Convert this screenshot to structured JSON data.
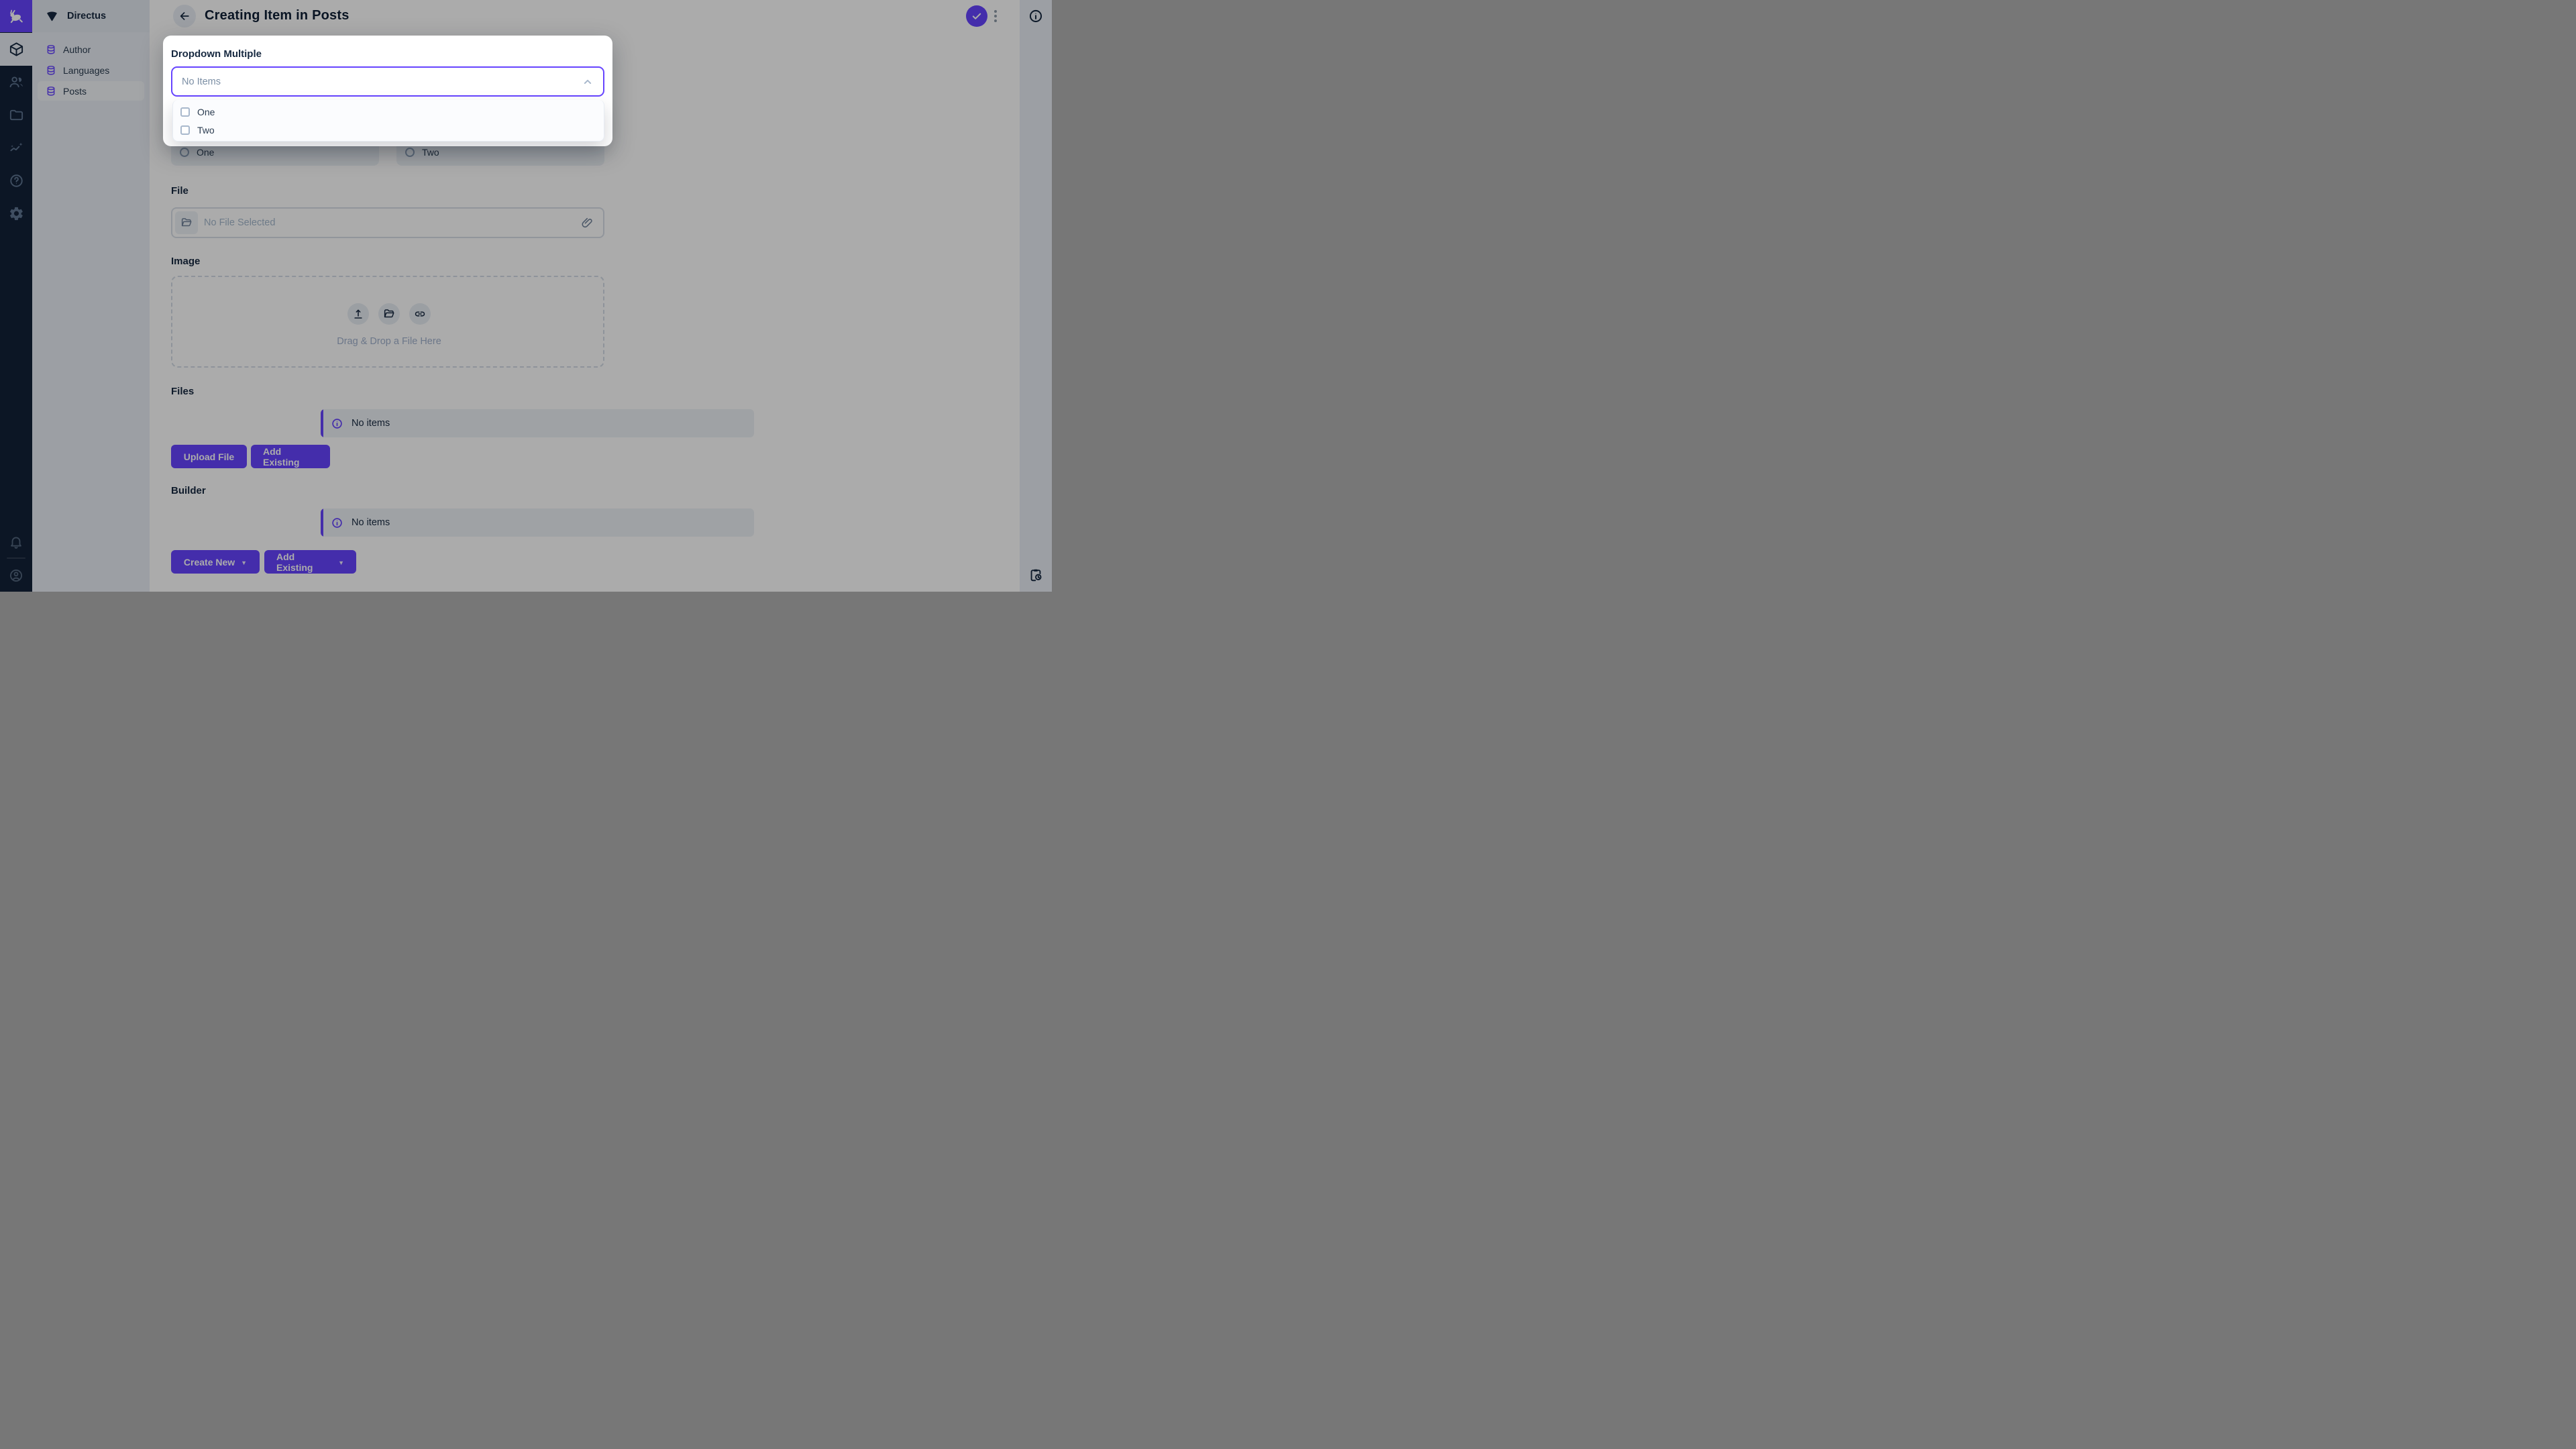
{
  "colors": {
    "accent": "#6644ff",
    "module_bar_bg": "#132238",
    "sidebar_bg": "#e9eef5",
    "notice_bg": "#eef2f7",
    "overlay": "rgba(0,0,0,0.33)"
  },
  "module_bar": {
    "logo_icon": "directus-rabbit-icon",
    "modules": [
      {
        "icon": "content-module-box-icon",
        "active": true
      },
      {
        "icon": "users-icon",
        "active": false
      },
      {
        "icon": "file-library-folder-icon",
        "active": false
      },
      {
        "icon": "insights-chart-icon",
        "active": false
      },
      {
        "icon": "help-question-icon",
        "active": false
      },
      {
        "icon": "settings-gear-icon",
        "active": false
      }
    ],
    "bottom": [
      {
        "icon": "notifications-bell-icon"
      },
      {
        "icon": "user-avatar-icon"
      }
    ]
  },
  "sidebar": {
    "project_name": "Directus",
    "project_icon": "project-fan-icon",
    "items": [
      {
        "label": "Author",
        "icon": "collection-database-icon",
        "active": false
      },
      {
        "label": "Languages",
        "icon": "collection-database-icon",
        "active": false
      },
      {
        "label": "Posts",
        "icon": "collection-database-icon",
        "active": true
      }
    ]
  },
  "header": {
    "title": "Creating Item in Posts",
    "back_icon": "arrow-left-icon",
    "save_icon": "check-icon",
    "menu_icon": "kebab-menu-icon"
  },
  "right_strip": {
    "top_icon": "info-icon",
    "bottom_icon": "clipboard-clock-icon"
  },
  "popover": {
    "field_label": "Dropdown Multiple",
    "select_value": "No Items",
    "chevron": "chevron-up-icon",
    "options": [
      {
        "label": "One",
        "checked": false
      },
      {
        "label": "Two",
        "checked": false
      }
    ]
  },
  "form": {
    "radio_options": [
      {
        "label": "One",
        "selected": false
      },
      {
        "label": "Two",
        "selected": false
      }
    ],
    "file": {
      "label": "File",
      "placeholder": "No File Selected",
      "left_icon": "folder-open-icon",
      "right_icon": "paperclip-icon"
    },
    "image": {
      "label": "Image",
      "dropzone_text": "Drag & Drop a File Here",
      "actions": [
        "upload-icon",
        "folder-open-icon",
        "link-icon"
      ]
    },
    "files": {
      "label": "Files",
      "empty_text": "No items",
      "buttons": [
        {
          "label": "Upload File"
        },
        {
          "label": "Add Existing"
        }
      ]
    },
    "builder": {
      "label": "Builder",
      "empty_text": "No items",
      "buttons": [
        {
          "label": "Create New",
          "caret": "▼"
        },
        {
          "label": "Add Existing",
          "caret": "▼"
        }
      ]
    }
  }
}
